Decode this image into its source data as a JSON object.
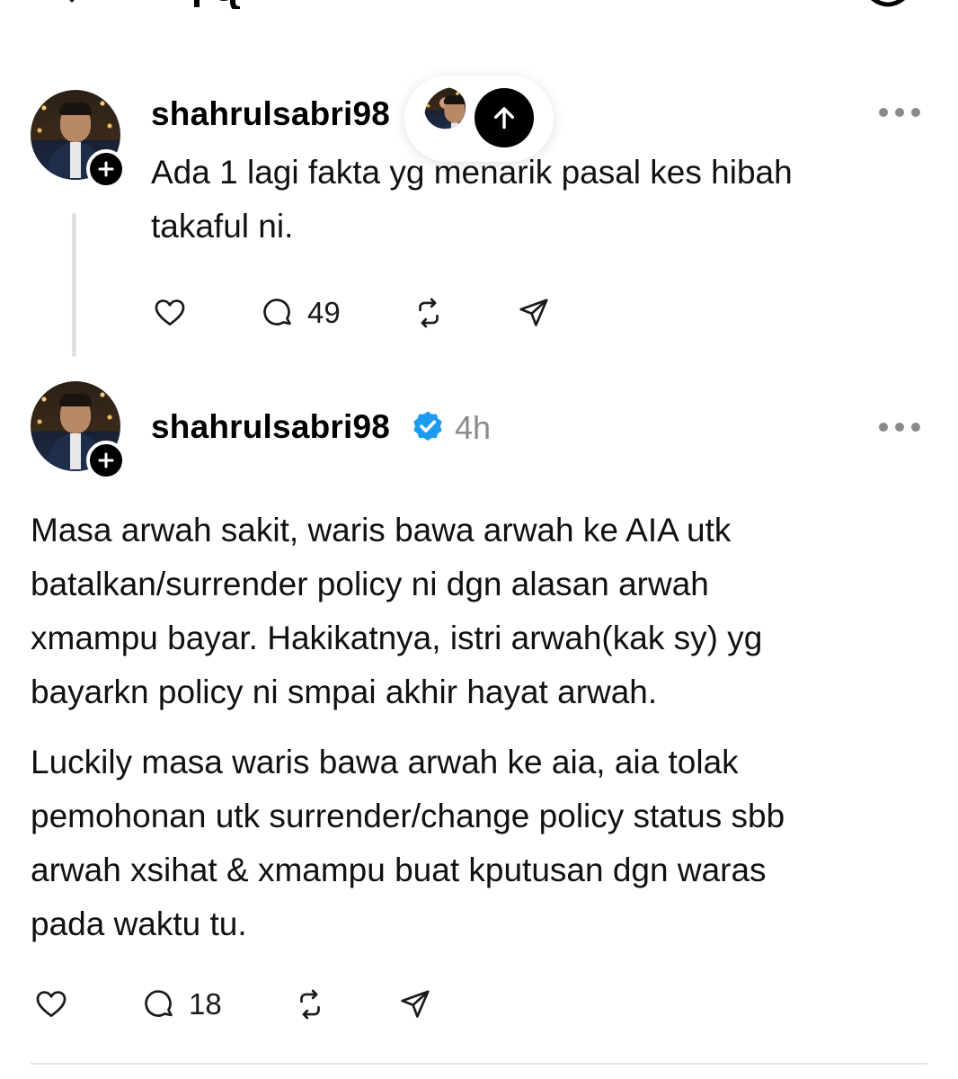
{
  "header": {
    "icons": [
      "back-arrow-icon",
      "settings-icon"
    ]
  },
  "float_button": {
    "icon": "arrow-up-icon"
  },
  "posts": [
    {
      "username": "shahrulsabri98",
      "text": [
        "Ada 1 lagi fakta yg menarik pasal kes hibah",
        "takaful ni."
      ],
      "likes": "",
      "replies": "49"
    },
    {
      "username": "shahrulsabri98",
      "verified": true,
      "time": "4h",
      "paragraphs": [
        [
          "Masa arwah sakit, waris bawa arwah ke AIA utk",
          "batalkan/surrender policy ni dgn alasan arwah",
          "xmampu bayar. Hakikatnya, istri arwah(kak sy) yg",
          "bayarkn policy ni smpai akhir hayat arwah."
        ],
        [
          "Luckily masa waris bawa arwah ke aia, aia tolak",
          "pemohonan utk surrender/change policy status sbb",
          "arwah xsihat & xmampu buat kputusan dgn waras",
          "pada waktu tu."
        ]
      ],
      "replies": "18"
    }
  ],
  "colors": {
    "verified": "#1d9bf0",
    "muted": "#8a8a8a"
  }
}
